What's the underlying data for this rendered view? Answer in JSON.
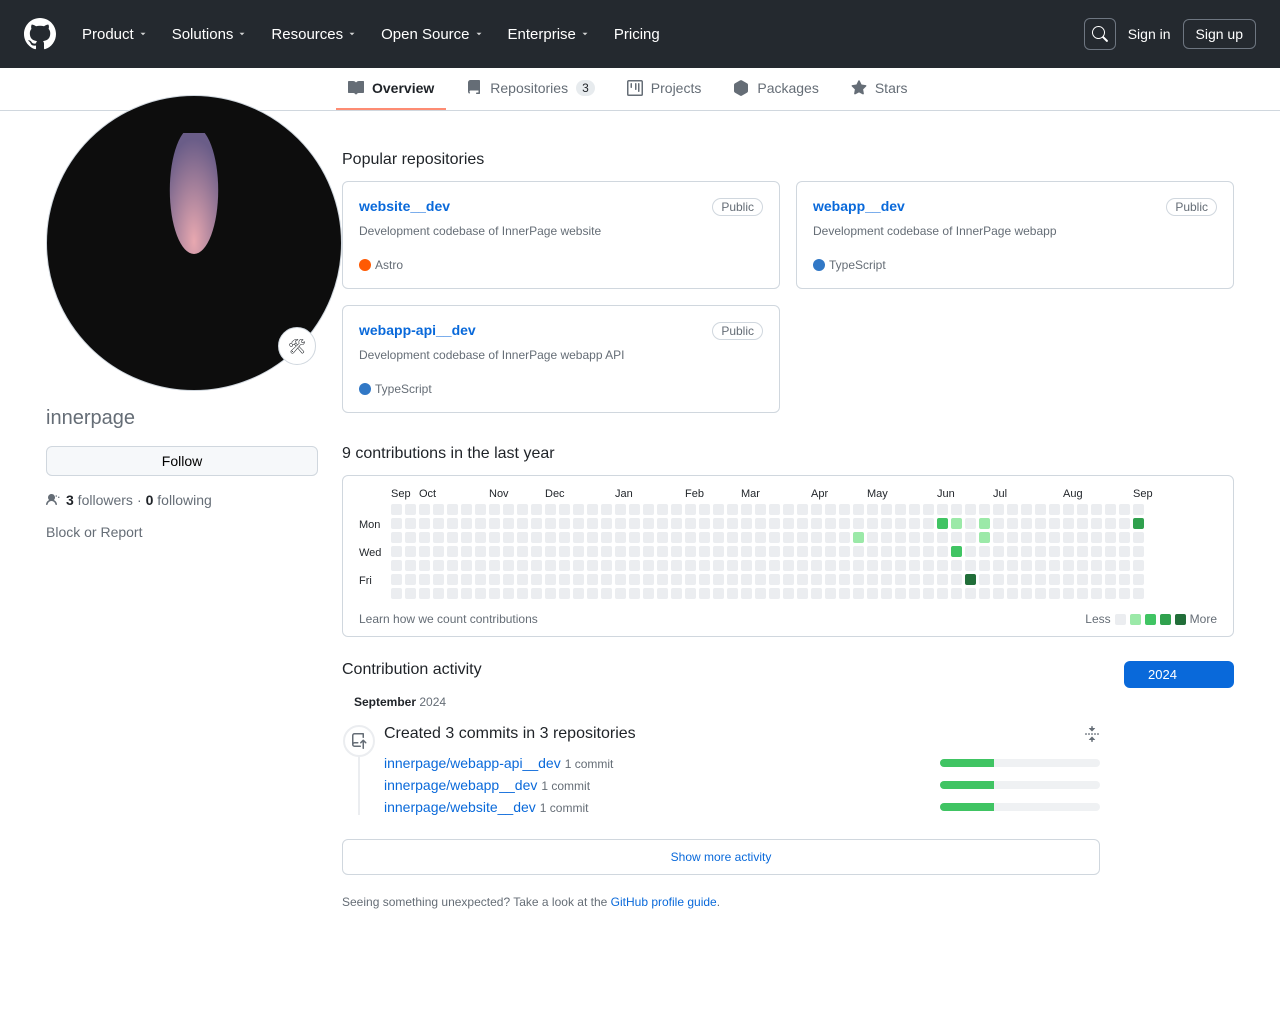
{
  "nav": {
    "product": "Product",
    "solutions": "Solutions",
    "resources": "Resources",
    "open_source": "Open Source",
    "enterprise": "Enterprise",
    "pricing": "Pricing",
    "signin": "Sign in",
    "signup": "Sign up"
  },
  "tabs": {
    "overview": "Overview",
    "repositories": "Repositories",
    "repo_count": "3",
    "projects": "Projects",
    "packages": "Packages",
    "stars": "Stars"
  },
  "profile": {
    "username": "innerpage",
    "follow": "Follow",
    "followers_n": "3",
    "followers_label": " followers",
    "sep": " · ",
    "following_n": "0",
    "following_label": " following",
    "block": "Block or Report"
  },
  "popular_title": "Popular repositories",
  "repos": [
    {
      "name": "website__dev",
      "vis": "Public",
      "desc": "Development codebase of InnerPage website",
      "lang": "Astro",
      "color": "#ff5a03"
    },
    {
      "name": "webapp__dev",
      "vis": "Public",
      "desc": "Development codebase of InnerPage webapp",
      "lang": "TypeScript",
      "color": "#3178c6"
    },
    {
      "name": "webapp-api__dev",
      "vis": "Public",
      "desc": "Development codebase of InnerPage webapp API",
      "lang": "TypeScript",
      "color": "#3178c6"
    }
  ],
  "contrib": {
    "title": "9 contributions in the last year",
    "learn": "Learn how we count contributions",
    "less": "Less",
    "more": "More",
    "months": [
      "Sep",
      "Oct",
      "Nov",
      "Dec",
      "Jan",
      "Feb",
      "Mar",
      "Apr",
      "May",
      "Jun",
      "Jul",
      "Aug",
      "Sep"
    ],
    "days": [
      "",
      "Mon",
      "",
      "Wed",
      "",
      "Fri",
      ""
    ]
  },
  "activity": {
    "title": "Contribution activity",
    "year": "2024",
    "month_b": "September ",
    "month_y": "2024",
    "created": "Created 3 commits in 3 repositories",
    "commits": [
      {
        "repo": "innerpage/webapp-api__dev",
        "count": "1 commit"
      },
      {
        "repo": "innerpage/webapp__dev",
        "count": "1 commit"
      },
      {
        "repo": "innerpage/website__dev",
        "count": "1 commit"
      }
    ],
    "show_more": "Show more activity",
    "footnote_pre": "Seeing something unexpected? Take a look at the ",
    "footnote_link": "GitHub profile guide"
  }
}
